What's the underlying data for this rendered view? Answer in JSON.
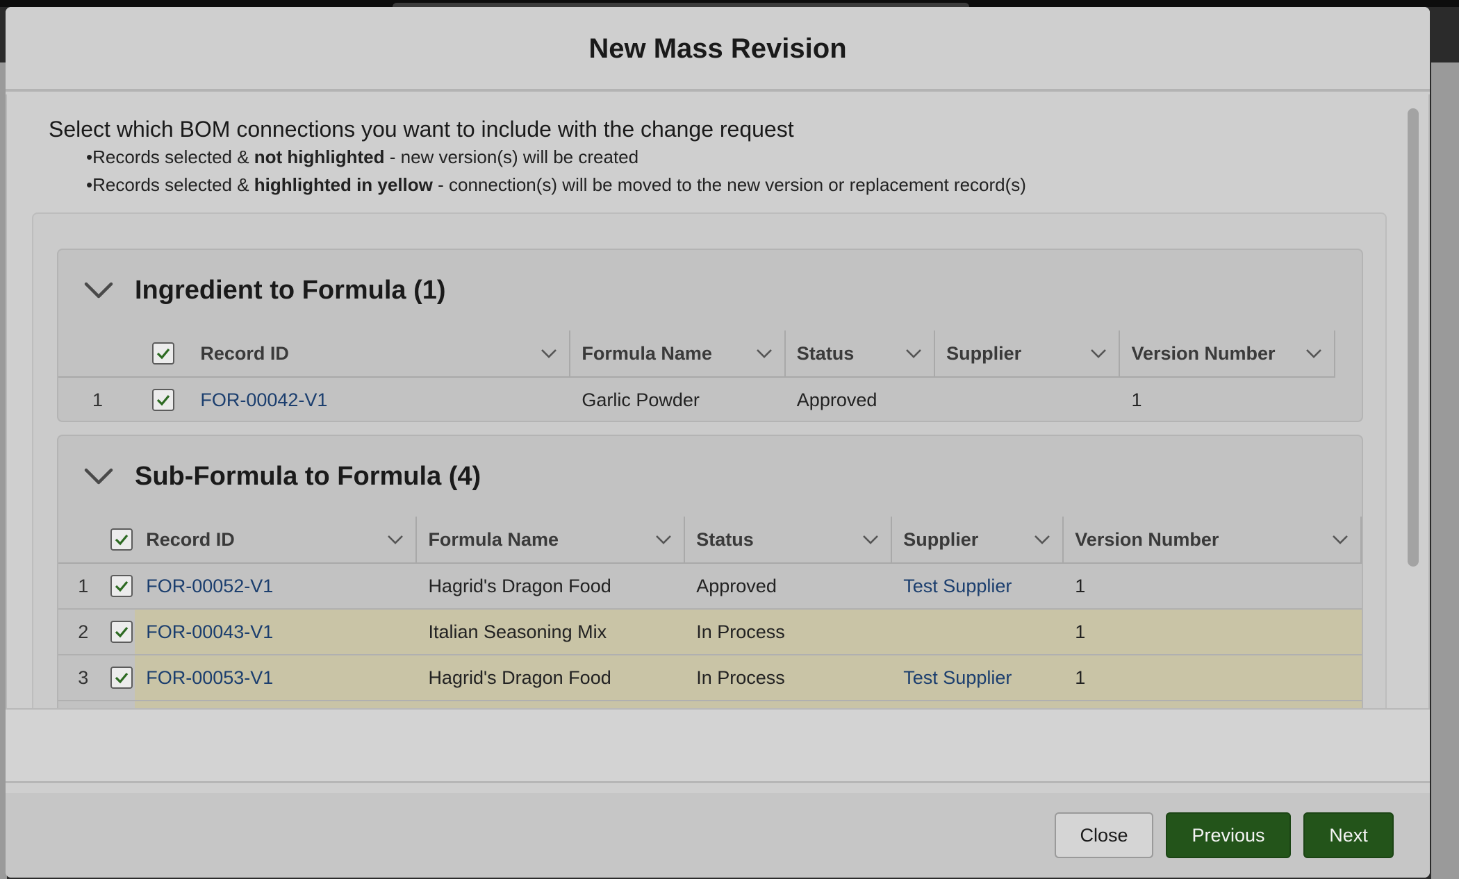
{
  "modal": {
    "title": "New Mass Revision"
  },
  "instructions": {
    "title": "Select which BOM connections you want to include with the change request",
    "line1": {
      "bullet": "•",
      "pre": "Records selected & ",
      "bold": "not highlighted",
      "post": " - new version(s) will be created"
    },
    "line2": {
      "bullet": "•",
      "pre": "Records selected & ",
      "bold": "highlighted in yellow",
      "post": " - connection(s) will be moved to the new version or replacement record(s)"
    }
  },
  "sections": [
    {
      "title": "Ingredient to Formula (1)",
      "columns": [
        "Record ID",
        "Formula Name",
        "Status",
        "Supplier",
        "Version Number"
      ],
      "rows": [
        {
          "num": "1",
          "record_id": "FOR-00042-V1",
          "formula_name": "Garlic Powder",
          "status": "Approved",
          "supplier": "",
          "version": "1",
          "highlighted": false
        }
      ]
    },
    {
      "title": "Sub-Formula to Formula (4)",
      "columns": [
        "Record ID",
        "Formula Name",
        "Status",
        "Supplier",
        "Version Number"
      ],
      "rows": [
        {
          "num": "1",
          "record_id": "FOR-00052-V1",
          "formula_name": "Hagrid's Dragon Food",
          "status": "Approved",
          "supplier": "Test Supplier",
          "version": "1",
          "highlighted": false
        },
        {
          "num": "2",
          "record_id": "FOR-00043-V1",
          "formula_name": "Italian Seasoning Mix",
          "status": "In Process",
          "supplier": "",
          "version": "1",
          "highlighted": true
        },
        {
          "num": "3",
          "record_id": "FOR-00053-V1",
          "formula_name": "Hagrid's Dragon Food",
          "status": "In Process",
          "supplier": "Test Supplier",
          "version": "1",
          "highlighted": true
        }
      ]
    }
  ],
  "footer": {
    "close_label": "Close",
    "previous_label": "Previous",
    "next_label": "Next"
  },
  "colors": {
    "brand": "#23541a",
    "highlight": "#c9c4a6",
    "link": "#1b3e6e"
  },
  "icons": {
    "section_toggle": "chevron-down-icon",
    "column_menu": "chevron-down-icon",
    "checkbox": "checkmark-icon"
  }
}
